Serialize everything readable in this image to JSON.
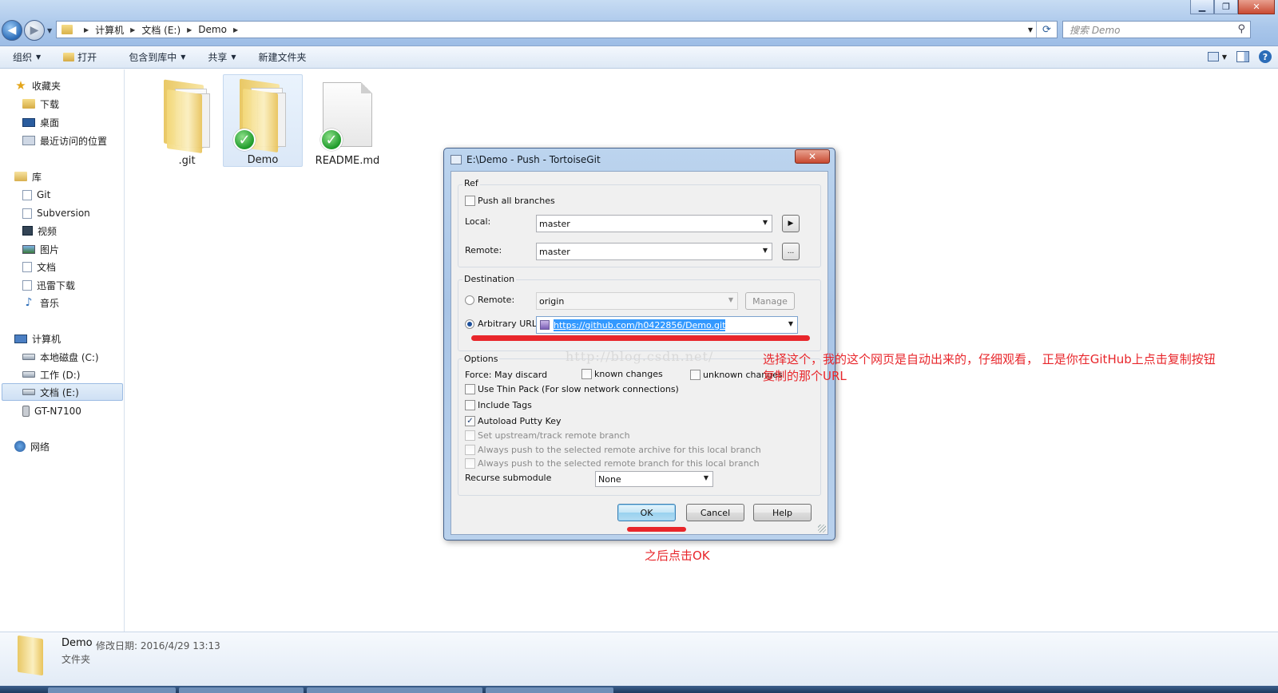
{
  "window": {
    "controls": [
      "minimize",
      "maximize",
      "close"
    ]
  },
  "address": {
    "crumbs": [
      "计算机",
      "文档 (E:)",
      "Demo"
    ]
  },
  "search": {
    "placeholder": "搜索 Demo"
  },
  "toolbar": {
    "organize": "组织",
    "open": "打开",
    "include": "包含到库中",
    "share": "共享",
    "new_folder": "新建文件夹"
  },
  "sidebar": {
    "favorites": "收藏夹",
    "downloads": "下载",
    "desktop": "桌面",
    "recent": "最近访问的位置",
    "libraries": "库",
    "git": "Git",
    "subversion": "Subversion",
    "videos": "视频",
    "pictures": "图片",
    "documents": "文档",
    "thunder": "迅雷下载",
    "music": "音乐",
    "computer": "计算机",
    "drive_c": "本地磁盘 (C:)",
    "drive_d": "工作 (D:)",
    "drive_e": "文档 (E:)",
    "device": "GT-N7100",
    "network": "网络"
  },
  "files": [
    {
      "name": ".git",
      "type": "folder",
      "synced": false
    },
    {
      "name": "Demo",
      "type": "folder",
      "synced": true
    },
    {
      "name": "README.md",
      "type": "file",
      "synced": true
    }
  ],
  "dialog": {
    "title": "E:\\Demo - Push - TortoiseGit",
    "ref_group": "Ref",
    "push_all": "Push all branches",
    "local_label": "Local:",
    "local_value": "master",
    "remote_label": "Remote:",
    "remote_value": "master",
    "remote_more": "...",
    "dest_group": "Destination",
    "dest_remote_label": "Remote:",
    "dest_remote_value": "origin",
    "manage": "Manage",
    "arbitrary_label": "Arbitrary URL:",
    "url": "https://github.com/h0422856/Demo.git",
    "options_group": "Options",
    "force_label": "Force: May discard",
    "known_changes": "known changes",
    "unknown_changes": "unknown changes",
    "thin_pack": "Use Thin Pack (For slow network connections)",
    "include_tags": "Include Tags",
    "autoload_putty": "Autoload Putty Key",
    "set_upstream": "Set upstream/track remote branch",
    "always_archive": "Always push to the selected remote archive for this local branch",
    "always_branch": "Always push to the selected remote branch for this local branch",
    "recurse_label": "Recurse submodule",
    "recurse_value": "None",
    "ok": "OK",
    "cancel": "Cancel",
    "help": "Help"
  },
  "annotations": {
    "watermark": "http://blog.csdn.net/",
    "note1_line1": "选择这个，我的这个网页是自动出来的，仔细观看， 正是你在GitHub上点击复制按钮",
    "note1_line2": "复制的那个URL",
    "note2": "之后点击OK",
    "color": "#e8262b"
  },
  "details": {
    "name": "Demo",
    "modified": "修改日期: 2016/4/29 13:13",
    "type": "文件夹"
  }
}
